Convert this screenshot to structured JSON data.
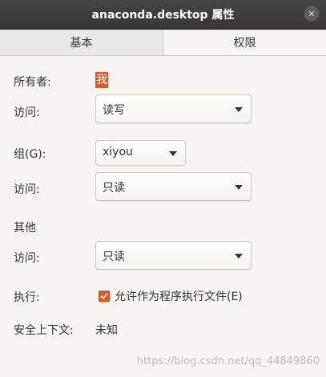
{
  "window": {
    "title": "anaconda.desktop 属性"
  },
  "tabs": [
    {
      "label": "基本"
    },
    {
      "label": "权限"
    }
  ],
  "owner": {
    "label": "所有者:",
    "value": "我"
  },
  "owner_access": {
    "label": "访问:",
    "value": "读写"
  },
  "group": {
    "label": "组(G):",
    "value": "xiyou"
  },
  "group_access": {
    "label": "访问:",
    "value": "只读"
  },
  "others": {
    "label": "其他"
  },
  "others_access": {
    "label": "访问:",
    "value": "只读"
  },
  "execute": {
    "label": "执行:",
    "checkbox_label": "允许作为程序执行文件(E)",
    "checked": true
  },
  "security_context": {
    "label": "安全上下文:",
    "value": "未知"
  },
  "watermark": "https://blog.csdn.net/qq_44849860",
  "colors": {
    "accent": "#e95420",
    "titlebar": "#3c3c3c",
    "background": "#f6f5f4"
  },
  "icons": {
    "close": "close-icon",
    "dropdown": "chevron-down-icon",
    "check": "check-icon"
  }
}
